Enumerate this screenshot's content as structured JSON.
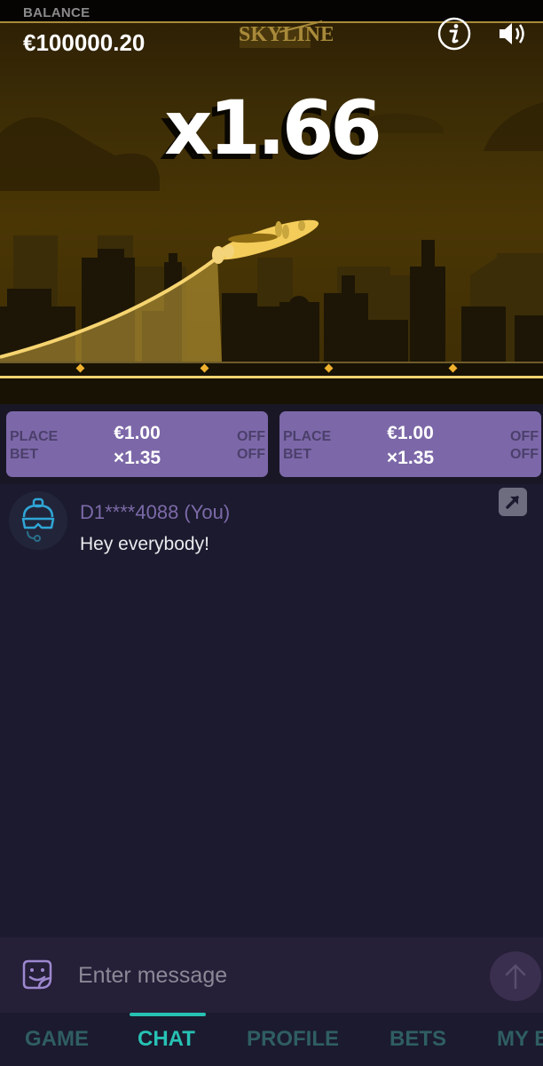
{
  "header": {
    "balance_label": "BALANCE",
    "balance_value": "€100000.20",
    "logo_text": "SKYLINER",
    "info_icon": "info-icon",
    "sound_icon": "speaker-icon"
  },
  "game": {
    "multiplier": "x1.66",
    "plane_icon": "airplane-icon",
    "colors": {
      "accent": "#f6d470",
      "sky": "#4a3605",
      "buildings": "#1d1606"
    }
  },
  "bets": [
    {
      "action": "PLACE BET",
      "action_line1": "PLACE",
      "action_line2": "BET",
      "amount": "€1.00",
      "auto_cashout": "×1.35",
      "toggle1": "OFF",
      "toggle2": "OFF"
    },
    {
      "action": "PLACE BET",
      "action_line1": "PLACE",
      "action_line2": "BET",
      "amount": "€1.00",
      "auto_cashout": "×1.35",
      "toggle1": "OFF",
      "toggle2": "OFF"
    }
  ],
  "chat": {
    "messages": [
      {
        "user": "D1****4088 (You)",
        "text": "Hey everybody!",
        "avatar_icon": "robot-avatar-icon"
      }
    ],
    "expand_icon": "arrow-up-right-icon",
    "input_placeholder": "Enter message",
    "emoji_icon": "sticker-smile-icon",
    "send_icon": "arrow-up-icon"
  },
  "nav": {
    "tabs": [
      {
        "label": "GAME",
        "active": false
      },
      {
        "label": "CHAT",
        "active": true
      },
      {
        "label": "PROFILE",
        "active": false
      },
      {
        "label": "BETS",
        "active": false
      },
      {
        "label": "MY BETS",
        "active": false
      }
    ],
    "accent_color": "#27c1b4"
  }
}
